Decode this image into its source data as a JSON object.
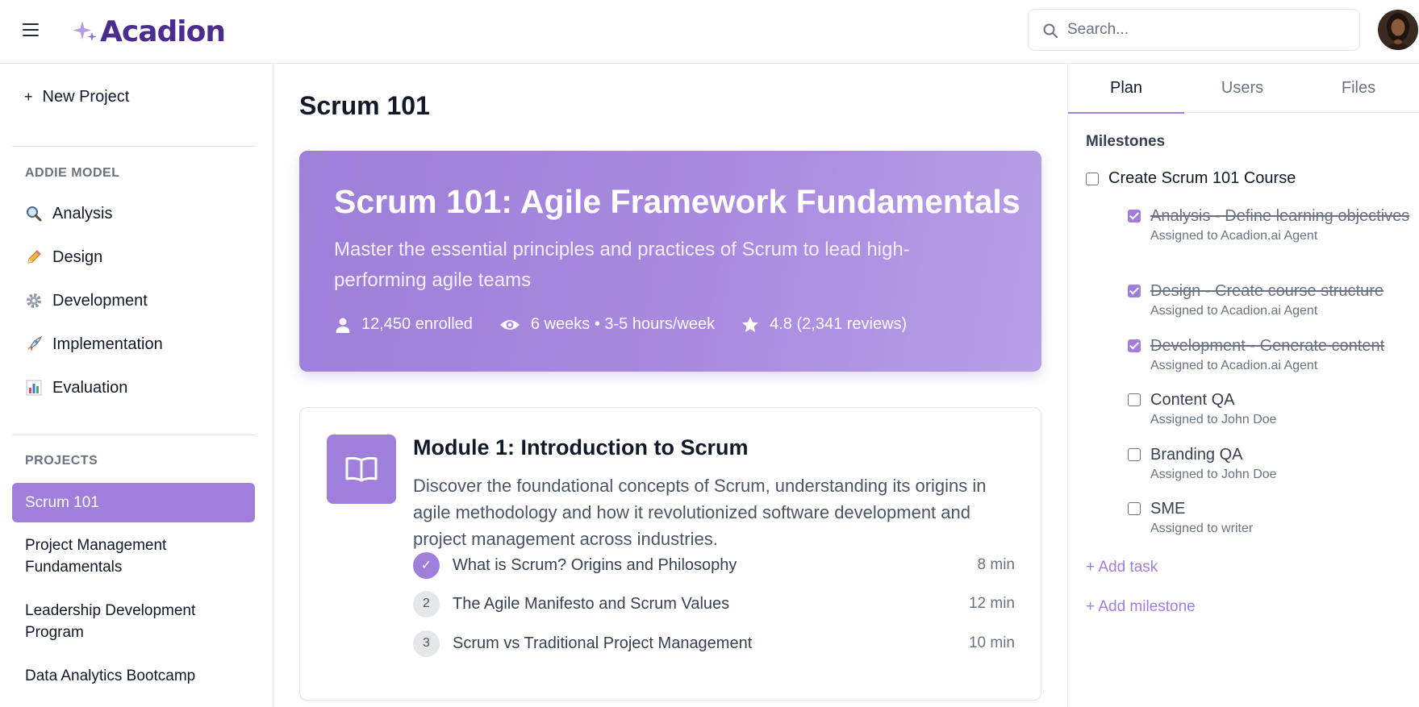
{
  "app": {
    "logo_text": "Acadion",
    "brand_color": "#4a2d8f",
    "accent_color": "#a07fdc"
  },
  "header": {
    "search_placeholder": "Search...",
    "menu_icon": "hamburger-menu-icon",
    "search_icon": "search-icon"
  },
  "sidebar": {
    "new_project_label": "New Project",
    "addie_title": "ADDIE MODEL",
    "addie_items": [
      {
        "label": "Analysis",
        "icon": "magnifier-emoji-icon"
      },
      {
        "label": "Design",
        "icon": "pencil-emoji-icon"
      },
      {
        "label": "Development",
        "icon": "gear-emoji-icon"
      },
      {
        "label": "Implementation",
        "icon": "rocket-emoji-icon"
      },
      {
        "label": "Evaluation",
        "icon": "bar-chart-emoji-icon"
      }
    ],
    "projects_title": "PROJECTS",
    "projects": [
      {
        "label": "Scrum 101",
        "active": true
      },
      {
        "label": "Project Management Fundamentals",
        "active": false
      },
      {
        "label": "Leadership Development Program",
        "active": false
      },
      {
        "label": "Data Analytics Bootcamp",
        "active": false
      }
    ]
  },
  "main": {
    "page_title": "Scrum 101",
    "hero": {
      "title": "Scrum 101: Agile Framework Fundamentals",
      "subtitle": "Master the essential principles and practices of Scrum to lead high-performing agile teams",
      "enrolled": "12,450 enrolled",
      "duration": "6 weeks • 3-5 hours/week",
      "rating": "4.8 (2,341 reviews)"
    },
    "module": {
      "title": "Module 1: Introduction to Scrum",
      "description": "Discover the foundational concepts of Scrum, understanding its origins in agile methodology and how it revolutionized software development and project management across industries.",
      "lessons": [
        {
          "number": "✓",
          "title": "What is Scrum? Origins and Philosophy",
          "duration": "8 min",
          "done": true
        },
        {
          "number": "2",
          "title": "The Agile Manifesto and Scrum Values",
          "duration": "12 min",
          "done": false
        },
        {
          "number": "3",
          "title": "Scrum vs Traditional Project Management",
          "duration": "10 min",
          "done": false
        }
      ]
    }
  },
  "right_panel": {
    "tabs": [
      {
        "label": "Plan",
        "active": true
      },
      {
        "label": "Users",
        "active": false
      },
      {
        "label": "Files",
        "active": false
      }
    ],
    "milestones_title": "Milestones",
    "milestone": {
      "label": "Create Scrum 101 Course",
      "checked": false
    },
    "tasks": [
      {
        "title": "Analysis - Define learning objectives",
        "assigned": "Assigned to Acadion.ai Agent",
        "done": true
      },
      {
        "title": "Design - Create course structure",
        "assigned": "Assigned to Acadion.ai Agent",
        "done": true
      },
      {
        "title": "Development - Generate content",
        "assigned": "Assigned to Acadion.ai Agent",
        "done": true
      },
      {
        "title": "Content QA",
        "assigned": "Assigned to John Doe",
        "done": false
      },
      {
        "title": "Branding QA",
        "assigned": "Assigned to John Doe",
        "done": false
      },
      {
        "title": "SME",
        "assigned": "Assigned to writer",
        "done": false
      }
    ],
    "add_task_label": "+ Add task",
    "add_milestone_label": "+ Add milestone"
  }
}
